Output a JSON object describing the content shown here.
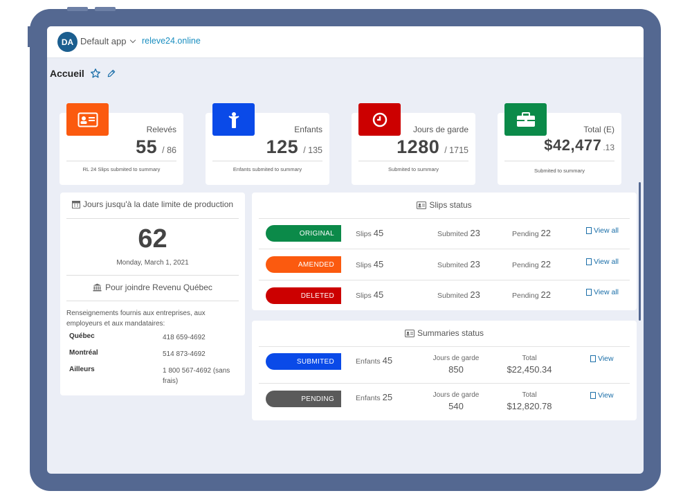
{
  "topbar": {
    "avatar": "DA",
    "app_name": "Default app",
    "site": "releve24.online"
  },
  "page": {
    "title": "Accueil"
  },
  "stats": [
    {
      "label": "Relevés",
      "value": "55",
      "total": "/ 86",
      "footer": "RL 24 Slips submited to summary",
      "color": "#fb5a0f"
    },
    {
      "label": "Enfants",
      "value": "125",
      "total": "/ 135",
      "footer": "Enfants submited to summary",
      "color": "#0a4ae8"
    },
    {
      "label": "Jours de garde",
      "value": "1280",
      "total": "/ 1715",
      "footer": "Submited to summary",
      "color": "#cc0000"
    },
    {
      "label": "Total (E)",
      "value": "$42,477",
      "total": ".13",
      "footer": "Submited to summary",
      "color": "#0b8a49"
    }
  ],
  "deadline": {
    "heading": "Jours jusqu'à la date limite de production",
    "days": "62",
    "date": "Monday, March 1, 2021",
    "contact_heading": "Pour joindre Revenu Québec",
    "info": "Renseignements fournis aux entreprises, aux employeurs et aux mandataires:",
    "contacts": [
      {
        "name": "Québec",
        "phone": "418 659-4692"
      },
      {
        "name": "Montréal",
        "phone": "514 873-4692"
      },
      {
        "name": "Ailleurs",
        "phone": "1 800 567-4692 (sans frais)"
      }
    ]
  },
  "slips": {
    "heading": "Slips status",
    "col_slips": "Slips",
    "col_submited": "Submited",
    "col_pending": "Pending",
    "view_label": "View all",
    "rows": [
      {
        "status": "ORIGINAL",
        "color": "#0b8a49",
        "slips": "45",
        "submited": "23",
        "pending": "22"
      },
      {
        "status": "AMENDED",
        "color": "#fb5a0f",
        "slips": "45",
        "submited": "23",
        "pending": "22"
      },
      {
        "status": "DELETED",
        "color": "#cc0000",
        "slips": "45",
        "submited": "23",
        "pending": "22"
      }
    ]
  },
  "summaries": {
    "heading": "Summaries status",
    "col_enfants": "Enfants",
    "col_jours": "Jours de garde",
    "col_total": "Total",
    "view_label": "View",
    "rows": [
      {
        "status": "SUBMITED",
        "color": "#0a4ae8",
        "enfants": "45",
        "jours": "850",
        "total": "$22,450.34"
      },
      {
        "status": "PENDING",
        "color": "#5a5a5a",
        "enfants": "25",
        "jours": "540",
        "total": "$12,820.78"
      }
    ]
  }
}
